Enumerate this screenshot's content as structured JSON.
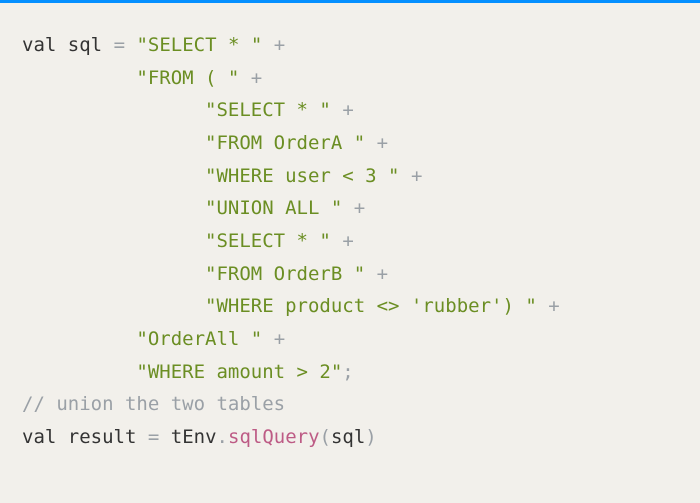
{
  "code": {
    "l1": {
      "kw": "val",
      "ident": "sql",
      "eq": "=",
      "str": "\"SELECT * \"",
      "plus": "+"
    },
    "l2": {
      "str": "\"FROM ( \"",
      "plus": "+"
    },
    "l3": {
      "str": "\"SELECT * \"",
      "plus": "+"
    },
    "l4": {
      "str": "\"FROM OrderA \"",
      "plus": "+"
    },
    "l5": {
      "str": "\"WHERE user < 3 \"",
      "plus": "+"
    },
    "l6": {
      "str": "\"UNION ALL \"",
      "plus": "+"
    },
    "l7": {
      "str": "\"SELECT * \"",
      "plus": "+"
    },
    "l8": {
      "str": "\"FROM OrderB \"",
      "plus": "+"
    },
    "l9": {
      "str": "\"WHERE product <> 'rubber') \"",
      "plus": "+"
    },
    "l10": {
      "str": "\"OrderAll \"",
      "plus": "+"
    },
    "l11": {
      "str": "\"WHERE amount > 2\"",
      "semi": ";"
    },
    "l12": {
      "comment": "// union the two tables"
    },
    "l13": {
      "kw": "val",
      "ident": "result",
      "eq": "=",
      "obj": "tEnv",
      "dot": ".",
      "call": "sqlQuery",
      "lp": "(",
      "arg": "sql",
      "rp": ")"
    }
  }
}
